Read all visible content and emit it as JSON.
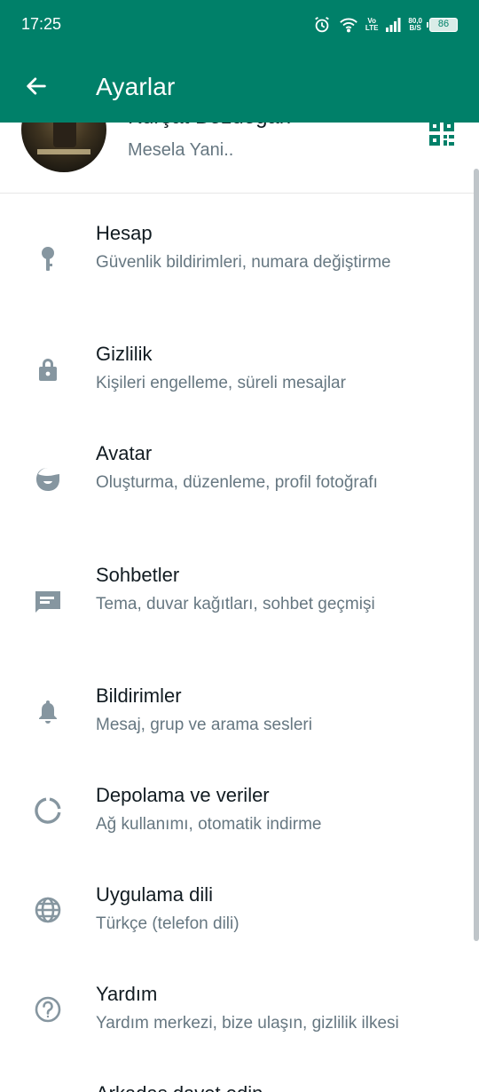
{
  "status_bar": {
    "time": "17:25",
    "network_top": "Vo",
    "network_bottom": "LTE",
    "speed_top": "80,0",
    "speed_bottom": "B/S",
    "battery": "86",
    "icons": [
      "alarm-icon",
      "wifi-icon",
      "signal-icon",
      "battery-icon"
    ]
  },
  "app_bar": {
    "title": "Ayarlar",
    "back_icon": "arrow-back-icon",
    "color": "#008069"
  },
  "profile": {
    "name": "Kürşat Bozdoğan",
    "about": "Mesela Yani..",
    "qr_icon": "qr-code-icon"
  },
  "settings": [
    {
      "icon": "key-icon",
      "title": "Hesap",
      "subtitle": "Güvenlik bildirimleri, numara değiştirme"
    },
    {
      "icon": "lock-icon",
      "title": "Gizlilik",
      "subtitle": "Kişileri engelleme, süreli mesajlar"
    },
    {
      "icon": "avatar-face-icon",
      "title": "Avatar",
      "subtitle": "Oluşturma, düzenleme, profil fotoğrafı"
    },
    {
      "icon": "chat-icon",
      "title": "Sohbetler",
      "subtitle": "Tema, duvar kağıtları, sohbet geçmişi"
    },
    {
      "icon": "bell-icon",
      "title": "Bildirimler",
      "subtitle": "Mesaj, grup ve arama sesleri"
    },
    {
      "icon": "storage-circle-icon",
      "title": "Depolama ve veriler",
      "subtitle": "Ağ kullanımı, otomatik indirme"
    },
    {
      "icon": "globe-icon",
      "title": "Uygulama dili",
      "subtitle": "Türkçe (telefon dili)"
    },
    {
      "icon": "help-icon",
      "title": "Yardım",
      "subtitle": "Yardım merkezi, bize ulaşın, gizlilik ilkesi"
    },
    {
      "icon": "people-icon",
      "title": "Arkadaş davet edin",
      "subtitle": ""
    }
  ],
  "colors": {
    "accent": "#008069",
    "icon_gray": "#8696a0",
    "title_text": "#111b21",
    "subtitle_text": "#667781"
  }
}
